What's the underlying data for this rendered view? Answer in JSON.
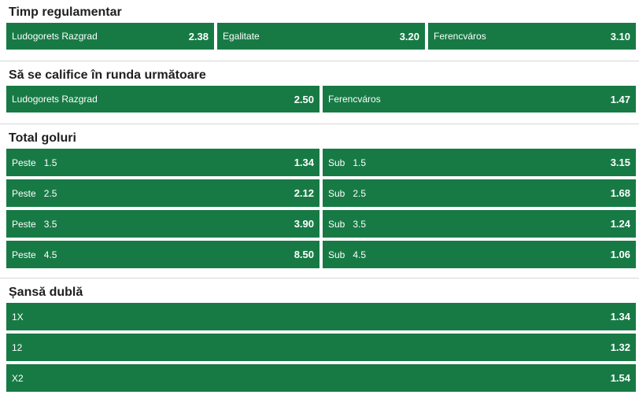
{
  "markets": [
    {
      "title": "Timp regulamentar",
      "rows": [
        [
          {
            "name": "Ludogorets Razgrad",
            "odd": "2.38"
          },
          {
            "name": "Egalitate",
            "odd": "3.20"
          },
          {
            "name": "Ferencváros",
            "odd": "3.10"
          }
        ]
      ]
    },
    {
      "title": "Să se califice în runda următoare",
      "rows": [
        [
          {
            "name": "Ludogorets Razgrad",
            "odd": "2.50"
          },
          {
            "name": "Ferencváros",
            "odd": "1.47"
          }
        ]
      ]
    },
    {
      "title": "Total goluri",
      "rows": [
        [
          {
            "name": "Peste",
            "line": "1.5",
            "odd": "1.34"
          },
          {
            "name": "Sub",
            "line": "1.5",
            "odd": "3.15"
          }
        ],
        [
          {
            "name": "Peste",
            "line": "2.5",
            "odd": "2.12"
          },
          {
            "name": "Sub",
            "line": "2.5",
            "odd": "1.68"
          }
        ],
        [
          {
            "name": "Peste",
            "line": "3.5",
            "odd": "3.90"
          },
          {
            "name": "Sub",
            "line": "3.5",
            "odd": "1.24"
          }
        ],
        [
          {
            "name": "Peste",
            "line": "4.5",
            "odd": "8.50"
          },
          {
            "name": "Sub",
            "line": "4.5",
            "odd": "1.06"
          }
        ]
      ]
    },
    {
      "title": "Șansă dublă",
      "rows": [
        [
          {
            "name": "1X",
            "odd": "1.34"
          }
        ],
        [
          {
            "name": "12",
            "odd": "1.32"
          }
        ],
        [
          {
            "name": "X2",
            "odd": "1.54"
          }
        ]
      ]
    }
  ],
  "colors": {
    "selection_bg": "#177a45",
    "selection_text": "#ffffff",
    "divider": "#d6d6d6"
  }
}
